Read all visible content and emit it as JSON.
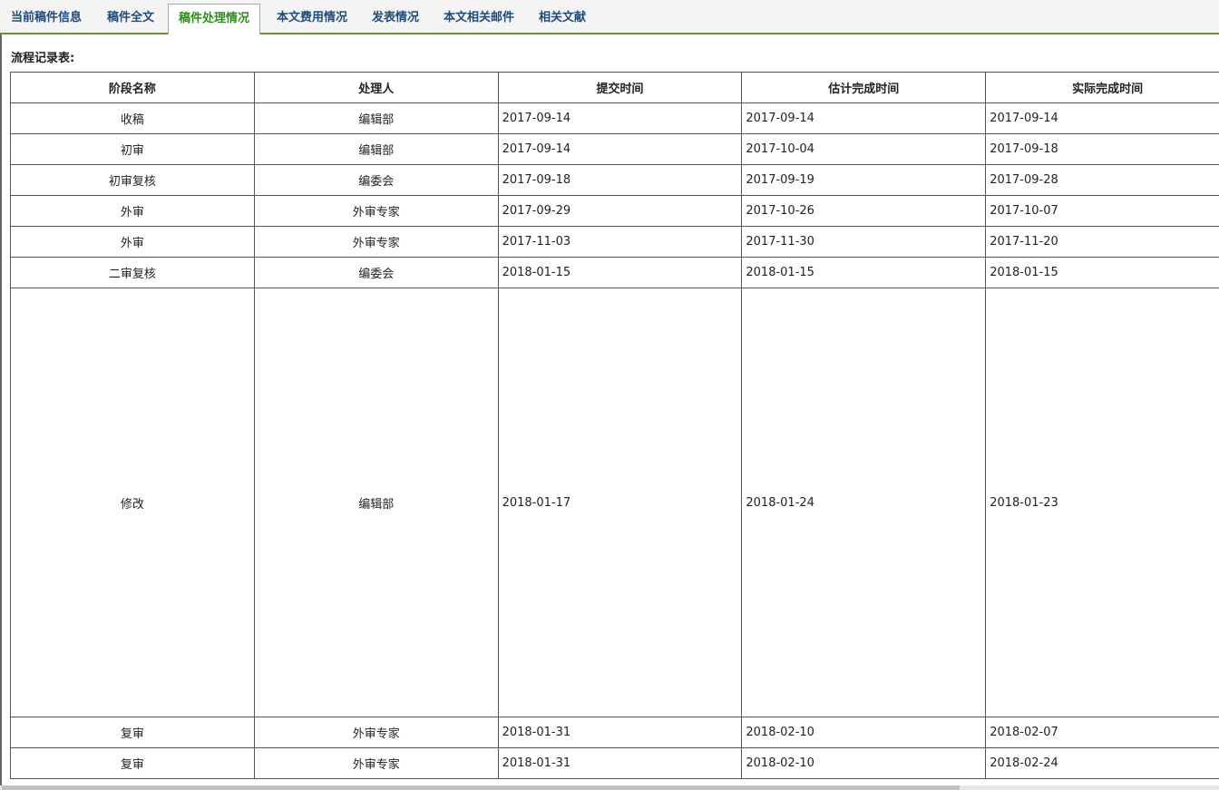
{
  "tabs": [
    "当前稿件信息",
    "稿件全文",
    "稿件处理情况",
    "本文费用情况",
    "发表情况",
    "本文相关邮件",
    "相关文献"
  ],
  "active_tab": "稿件处理情况",
  "caption": "流程记录表:",
  "table": {
    "headers": [
      "阶段名称",
      "处理人",
      "提交时间",
      "估计完成时间",
      "实际完成时间"
    ],
    "rows": [
      [
        "收稿",
        "编辑部",
        "2017-09-14",
        "2017-09-14",
        "2017-09-14"
      ],
      [
        "初审",
        "编辑部",
        "2017-09-14",
        "2017-10-04",
        "2017-09-18"
      ],
      [
        "初审复核",
        "编委会",
        "2017-09-18",
        "2017-09-19",
        "2017-09-28"
      ],
      [
        "外审",
        "外审专家",
        "2017-09-29",
        "2017-10-26",
        "2017-10-07"
      ],
      [
        "外审",
        "外审专家",
        "2017-11-03",
        "2017-11-30",
        "2017-11-20"
      ],
      [
        "二审复核",
        "编委会",
        "2018-01-15",
        "2018-01-15",
        "2018-01-15"
      ],
      [
        "修改",
        "编辑部",
        "2018-01-17",
        "2018-01-24",
        "2018-01-23"
      ],
      [
        "复审",
        "外审专家",
        "2018-01-31",
        "2018-02-10",
        "2018-02-07"
      ],
      [
        "复审",
        "外审专家",
        "2018-01-31",
        "2018-02-10",
        "2018-02-24"
      ]
    ]
  }
}
